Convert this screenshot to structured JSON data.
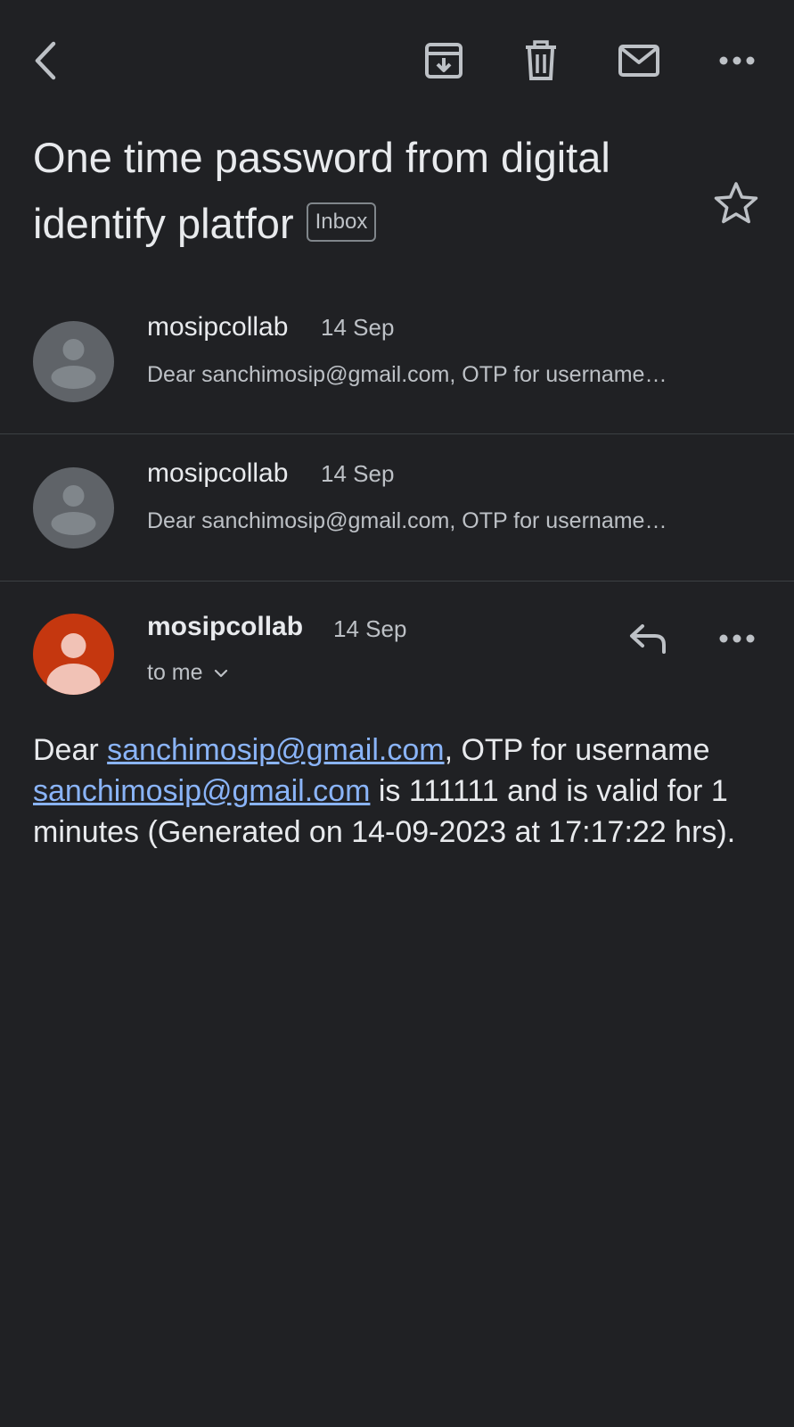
{
  "toolbar": {
    "back_icon": "chevron-left-icon",
    "archive_icon": "archive-icon",
    "delete_icon": "trash-icon",
    "mark_unread_icon": "mail-icon",
    "more_icon": "more-horizontal-icon"
  },
  "subject": {
    "title": "One time password from digital identify platfor",
    "label": "Inbox"
  },
  "thread": [
    {
      "sender": "mosipcollab",
      "date": "14 Sep",
      "snippet": "Dear sanchimosip@gmail.com, OTP for username…",
      "expanded": false
    },
    {
      "sender": "mosipcollab",
      "date": "14 Sep",
      "snippet": "Dear sanchimosip@gmail.com, OTP for username…",
      "expanded": false
    }
  ],
  "open_message": {
    "sender": "mosipcollab",
    "date": "14 Sep",
    "recipient": "to me",
    "body": {
      "part1": "Dear ",
      "link1": "sanchimosip@gmail.com",
      "part2": ", OTP for username ",
      "link2": "sanchimosip@gmail.com",
      "part3": " is 111111 and is valid for 1 minutes (Generated on 14-09-2023 at 17:17:22 hrs)."
    }
  },
  "colors": {
    "background": "#202124",
    "link": "#8ab4f8",
    "avatar_grey": "#5f6368",
    "avatar_red": "#c5370f"
  }
}
